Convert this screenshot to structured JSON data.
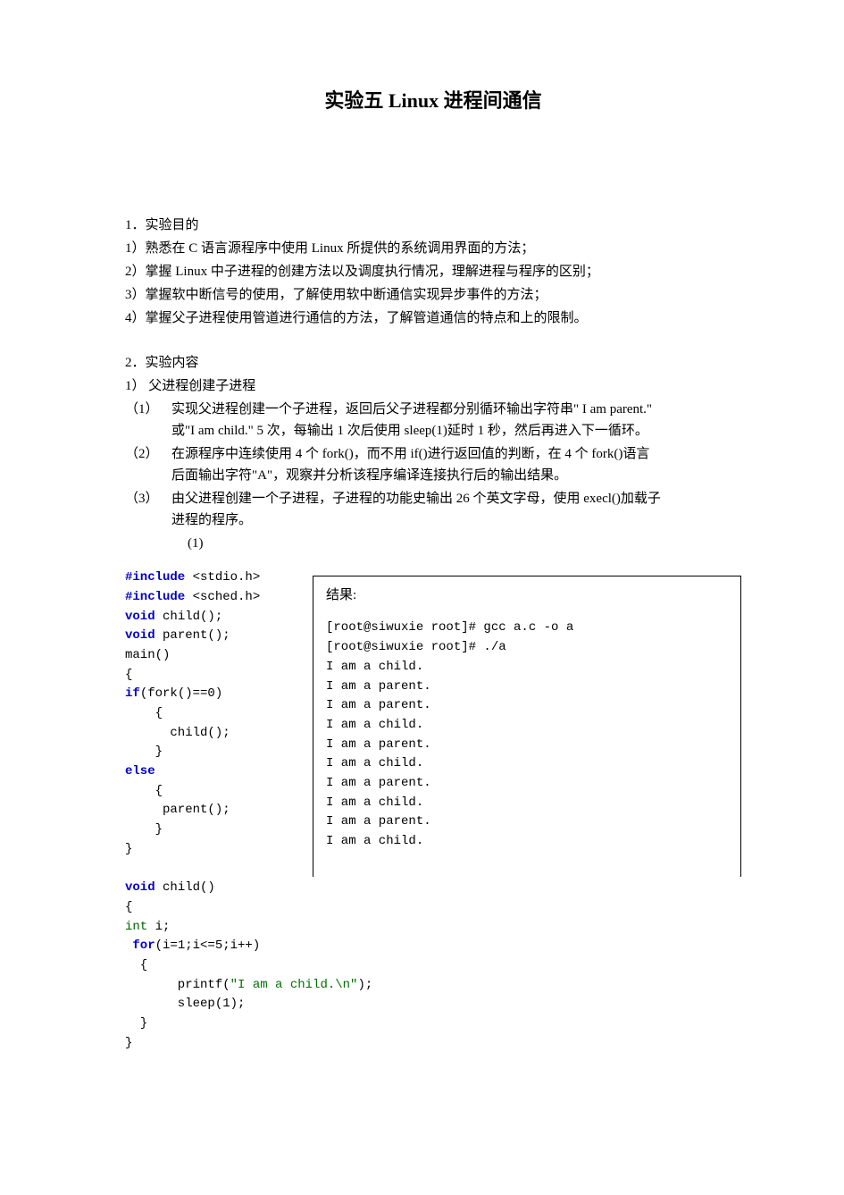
{
  "title": "实验五 Linux 进程间通信",
  "sec1": {
    "heading": "1．实验目的",
    "items": [
      "1）熟悉在 C 语言源程序中使用 Linux 所提供的系统调用界面的方法；",
      "2）掌握 Linux 中子进程的创建方法以及调度执行情况，理解进程与程序的区别；",
      "3）掌握软中断信号的使用，了解使用软中断通信实现异步事件的方法；",
      "4）掌握父子进程使用管道进行通信的方法，了解管道通信的特点和上的限制。"
    ]
  },
  "sec2": {
    "heading": "2．实验内容",
    "subheading": "1） 父进程创建子进程",
    "tasks": [
      {
        "num": "（1）",
        "line1": "实现父进程创建一个子进程，返回后父子进程都分别循环输出字符串\" I am parent.\"",
        "line2": "或\"I am child.\" 5 次，每输出 1 次后使用 sleep(1)延时 1 秒，然后再进入下一循环。"
      },
      {
        "num": "（2）",
        "line1": "在源程序中连续使用 4 个 fork()，而不用 if()进行返回值的判断，在 4 个 fork()语言",
        "line2": "后面输出字符\"A\"，观察并分析该程序编译连接执行后的输出结果。"
      },
      {
        "num": "（3）",
        "line1": "由父进程创建一个子进程，子进程的功能史输出 26 个英文字母，使用 execl()加载子",
        "line2": "进程的程序。"
      }
    ],
    "sublabel": "(1)"
  },
  "code": {
    "l1a": "#include",
    "l1b": " <stdio.h>",
    "l2a": "#include",
    "l2b": " <sched.h>",
    "l3a": "void",
    "l3b": " child();",
    "l4a": "void",
    "l4b": " parent();",
    "l5": "main()",
    "l6": "{",
    "l7a": "if",
    "l7b": "(fork()==0)",
    "l8": "    {",
    "l9": "      child();",
    "l10": "    }",
    "l11": "else",
    "l12": "    {",
    "l13": "     parent();",
    "l14": "    }",
    "l15": "}",
    "l16": "",
    "l17a": "void",
    "l17b": " child()",
    "l18": "{",
    "l19a": "int",
    "l19b": " i;",
    "l20a": " for",
    "l20b": "(i=1;i<=5;i++)",
    "l21": "  {",
    "l22a": "       printf(",
    "l22b": "\"I am a child.\\n\"",
    "l22c": ");",
    "l23": "       sleep(1);",
    "l24": "  }",
    "l25": "}"
  },
  "result": {
    "label": "结果:",
    "lines": [
      "[root@siwuxie root]# gcc a.c -o a",
      "[root@siwuxie root]# ./a",
      "I am a child.",
      "I am a parent.",
      "I am a parent.",
      "I am a child.",
      "I am a parent.",
      "I am a child.",
      "I am a parent.",
      "I am a child.",
      "I am a parent.",
      "I am a child."
    ]
  }
}
